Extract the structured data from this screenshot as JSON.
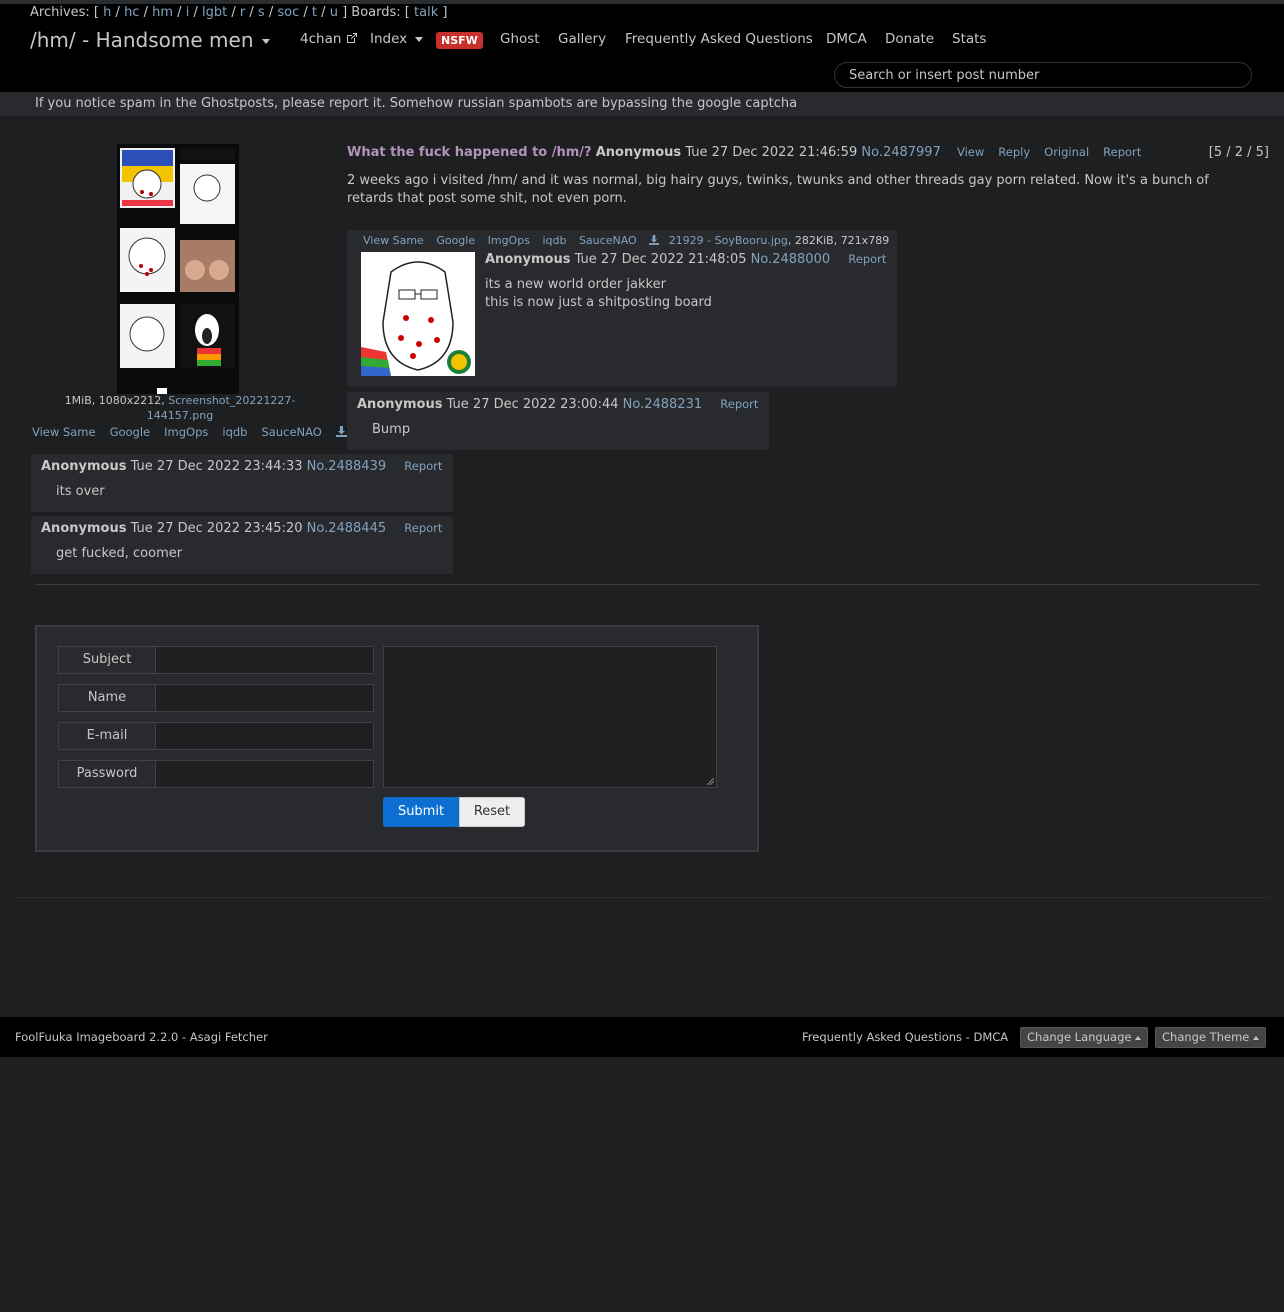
{
  "archives": {
    "prefix": "Archives: [",
    "boards": [
      "h",
      "hc",
      "hm",
      "i",
      "lgbt",
      "r",
      "s",
      "soc",
      "t",
      "u"
    ],
    "boards_sep": "/",
    "boards_label": "] Boards: [",
    "other_boards": [
      "talk"
    ],
    "suffix": "]"
  },
  "navbar": {
    "brand": "/hm/ - Handsome men",
    "items": {
      "fourchan": "4chan",
      "index": "Index",
      "nsfw": "NSFW",
      "ghost": "Ghost",
      "gallery": "Gallery",
      "faq": "Frequently Asked Questions",
      "dmca": "DMCA",
      "donate": "Donate",
      "stats": "Stats"
    },
    "search_placeholder": "Search or insert post number"
  },
  "notice": "If you notice spam in the Ghostposts, please report it. Somehow russian spambots are bypassing the google captcha",
  "op": {
    "file_info_prefix": "1MiB, 1080x2212, ",
    "file_name": "Screenshot_20221227-144157.png",
    "file_links": [
      "View Same",
      "Google",
      "ImgOps",
      "iqdb",
      "SauceNAO"
    ],
    "subject": "What the fuck happened to /hm/?",
    "name": "Anonymous",
    "date": "Tue 27 Dec 2022 21:46:59",
    "number": "No.2487997",
    "controls": [
      "View",
      "Reply",
      "Original",
      "Report"
    ],
    "pager": "[5 / 2 / 5]",
    "text": "2 weeks ago i visited /hm/ and it was normal, big hairy guys, twinks, twunks and other threads gay porn related. Now it's a bunch of retards that post some shit, not even porn."
  },
  "replies": [
    {
      "file_links": [
        "View Same",
        "Google",
        "ImgOps",
        "iqdb",
        "SauceNAO"
      ],
      "file_name": "21929 - SoyBooru.jpg",
      "file_meta": ", 282KiB, 721x789",
      "name": "Anonymous",
      "date": "Tue 27 Dec 2022 21:48:05",
      "number": "No.2488000",
      "report": "Report",
      "text": [
        "its a new world order jakker",
        "this is now just a shitposting board"
      ]
    },
    {
      "name": "Anonymous",
      "date": "Tue 27 Dec 2022 23:00:44",
      "number": "No.2488231",
      "report": "Report",
      "text": [
        "Bump"
      ]
    },
    {
      "name": "Anonymous",
      "date": "Tue 27 Dec 2022 23:44:33",
      "number": "No.2488439",
      "report": "Report",
      "text": [
        "its over"
      ]
    },
    {
      "name": "Anonymous",
      "date": "Tue 27 Dec 2022 23:45:20",
      "number": "No.2488445",
      "report": "Report",
      "text": [
        "get fucked, coomer"
      ]
    }
  ],
  "form": {
    "subject": "Subject",
    "name": "Name",
    "email": "E-mail",
    "password": "Password",
    "submit": "Submit",
    "reset": "Reset"
  },
  "footer": {
    "credit": "FoolFuuka Imageboard 2.2.0 - Asagi Fetcher",
    "links": "Frequently Asked Questions - DMCA",
    "change_language": "Change Language",
    "change_theme": "Change Theme"
  },
  "colors": {
    "background": "#1d1f21",
    "post_bg": "#282a2e",
    "link": "#81a2be",
    "subject": "#b294bb",
    "nsfw": "#c9302c",
    "submit": "#0d6ed1"
  }
}
